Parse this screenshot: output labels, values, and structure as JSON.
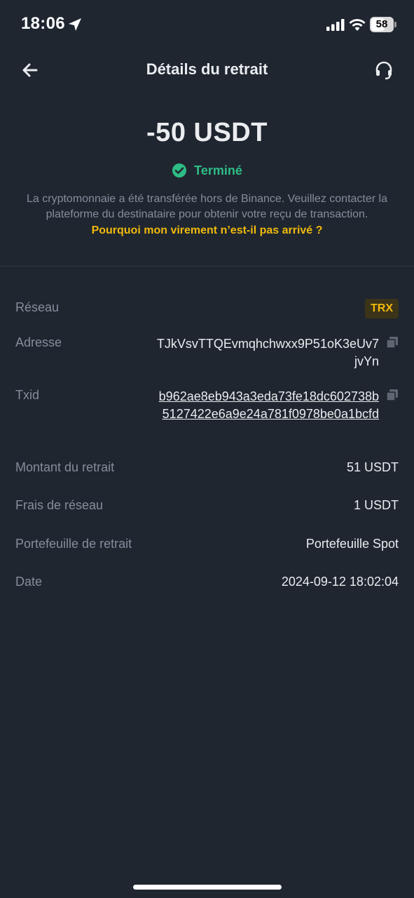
{
  "status_bar": {
    "time": "18:06",
    "battery": "58",
    "icons": [
      "location-arrow-icon",
      "signal-icon",
      "wifi-icon",
      "battery-icon"
    ]
  },
  "header": {
    "title": "Détails du retrait",
    "back_icon": "arrow-left-icon",
    "support_icon": "headset-icon"
  },
  "summary": {
    "amount": "-50 USDT",
    "status": "Terminé",
    "status_icon": "check-circle-icon",
    "description": "La cryptomonnaie a été transférée hors de Binance. Veuillez contacter la plateforme du destinataire pour obtenir votre reçu de transaction.",
    "help_link": "Pourquoi mon virement n’est-il pas arrivé ?"
  },
  "details": {
    "network_label": "Réseau",
    "network_value": "TRX",
    "address_label": "Adresse",
    "address_value": "TJkVsvTTQEvmqhchwxx9P51oK3eUv7jvYn",
    "txid_label": "Txid",
    "txid_value": "b962ae8eb943a3eda73fe18dc602738b5127422e6a9e24a781f0978be0a1bcfd",
    "amount_label": "Montant du retrait",
    "amount_value": "51 USDT",
    "fee_label": "Frais de réseau",
    "fee_value": "1 USDT",
    "wallet_label": "Portefeuille de retrait",
    "wallet_value": "Portefeuille Spot",
    "date_label": "Date",
    "date_value": "2024-09-12 18:02:04"
  },
  "colors": {
    "background": "#1f2630",
    "primary_text": "#eaecef",
    "secondary_text": "#848e9c",
    "success": "#2ebd85",
    "accent": "#f0b90b"
  }
}
